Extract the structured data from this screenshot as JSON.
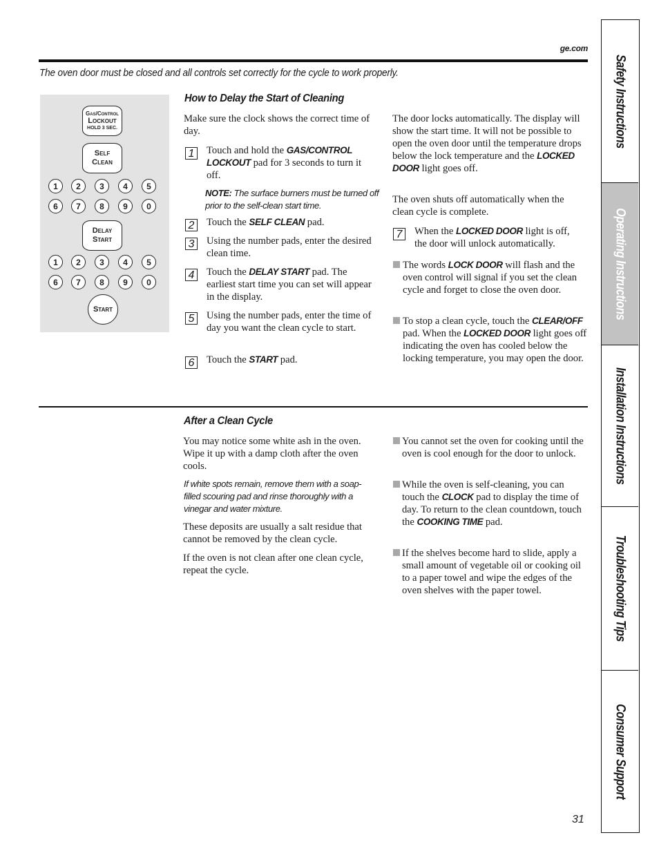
{
  "header": {
    "site": "ge.com",
    "notice": "The oven door must be closed and all controls set correctly for the cycle to work properly."
  },
  "keypad": {
    "lockout_pad": {
      "line1": "Gas/Control",
      "line2": "Lockout",
      "line3": "HOLD 3 SEC."
    },
    "self_clean_pad": {
      "line1": "Self",
      "line2": "Clean"
    },
    "number_rows_1": [
      [
        "1",
        "2",
        "3",
        "4",
        "5"
      ],
      [
        "6",
        "7",
        "8",
        "9",
        "0"
      ]
    ],
    "delay_start_pad": {
      "line1": "Delay",
      "line2": "Start"
    },
    "number_rows_2": [
      [
        "1",
        "2",
        "3",
        "4",
        "5"
      ],
      [
        "6",
        "7",
        "8",
        "9",
        "0"
      ]
    ],
    "start_pad": "Start"
  },
  "delay_section": {
    "title": "How to Delay the Start of Cleaning",
    "intro": "Make sure the clock shows the correct time of day.",
    "steps": [
      {
        "n": "1",
        "before": "Touch and hold the ",
        "kw": "GAS/CONTROL LOCKOUT",
        "after": " pad for 3 seconds to turn it off."
      },
      {
        "n": "2",
        "before": "Touch the ",
        "kw": "SELF CLEAN",
        "after": " pad."
      },
      {
        "n": "3",
        "before": "Using the number pads, enter the desired clean time.",
        "kw": "",
        "after": ""
      },
      {
        "n": "4",
        "before": "Touch the ",
        "kw": "DELAY START",
        "after": " pad. The earliest start time you can set will appear in the display."
      },
      {
        "n": "5",
        "before": "Using the number pads, enter the time of day you want the clean cycle to start.",
        "kw": "",
        "after": ""
      },
      {
        "n": "6",
        "before": "Touch the ",
        "kw": "START",
        "after": " pad."
      },
      {
        "n": "7",
        "before": "When the ",
        "kw": "LOCKED DOOR",
        "after": " light is off, the door will unlock automatically."
      }
    ],
    "note_label": "NOTE:",
    "note_text": " The surface burners must be turned off prior to the self-clean start time.",
    "right_p1_before": "The door locks automatically. The display will show the start time. It will not be possible to open the oven door until the temperature drops below the lock temperature and the ",
    "right_p1_kw": "LOCKED DOOR",
    "right_p1_after": " light goes off.",
    "right_p2": "The oven shuts off automatically when the clean cycle is complete.",
    "bullets": [
      {
        "before": "The words ",
        "kw": "LOCK DOOR",
        "after": " will flash and the oven control will signal if you set the clean cycle and forget to close the oven door."
      },
      {
        "before": "To stop a clean cycle, touch the ",
        "kw": "CLEAR/OFF",
        "mid": " pad. When the ",
        "kw2": "LOCKED DOOR",
        "after": " light goes off indicating the oven has cooled below the locking temperature, you may open the door."
      }
    ]
  },
  "after_section": {
    "title": "After a Clean Cycle",
    "p1": "You may notice some white ash in the oven. Wipe it up with a damp cloth after the oven cools.",
    "italic_note": "If white spots remain, remove them with a soap-filled scouring pad and rinse thoroughly with a vinegar and water mixture.",
    "p2": "These deposits are usually a salt residue that cannot be removed by the clean cycle.",
    "p3": "If the oven is not clean after one clean cycle, repeat the cycle.",
    "bullets": [
      {
        "before": "You cannot set the oven for cooking until the oven is cool enough for the door to unlock."
      },
      {
        "before": "While the oven is self-cleaning, you can touch the ",
        "kw": "CLOCK",
        "mid": " pad to display the time of day. To return to the clean countdown, touch the ",
        "kw2": "COOKING TIME",
        "after": " pad."
      },
      {
        "before": "If the shelves become hard to slide, apply a small amount of vegetable oil or cooking oil to a paper towel and wipe the edges of the oven shelves with the paper towel."
      }
    ]
  },
  "side_tabs": [
    {
      "label": "Safety Instructions",
      "active": false
    },
    {
      "label": "Operating Instructions",
      "active": true
    },
    {
      "label": "Installation Instructions",
      "active": false
    },
    {
      "label": "Troubleshooting Tips",
      "active": false
    },
    {
      "label": "Consumer Support",
      "active": false
    }
  ],
  "page_number": "31",
  "colors": {
    "panel_gray": "#e3e3e3",
    "active_tab": "#c2c2c2",
    "bullet_gray": "#a8a8a8"
  }
}
